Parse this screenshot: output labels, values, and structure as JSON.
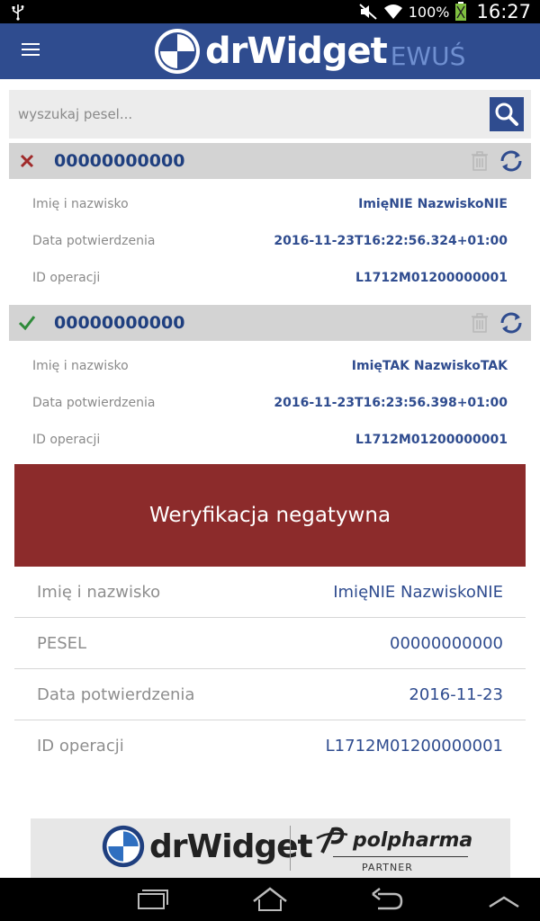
{
  "status_bar": {
    "battery": "100%",
    "time": "16:27"
  },
  "app_bar": {
    "brand": "drWidget",
    "brand_sub": "EWUŚ"
  },
  "search": {
    "placeholder": "wyszukaj pesel..."
  },
  "records": [
    {
      "status": "negative",
      "pesel": "00000000000",
      "rows": [
        {
          "label": "Imię i nazwisko",
          "value": "ImięNIE NazwiskoNIE"
        },
        {
          "label": "Data potwierdzenia",
          "value": "2016-11-23T16:22:56.324+01:00"
        },
        {
          "label": "ID operacji",
          "value": "L1712M01200000001"
        }
      ]
    },
    {
      "status": "positive",
      "pesel": "00000000000",
      "rows": [
        {
          "label": "Imię i nazwisko",
          "value": "ImięTAK NazwiskoTAK"
        },
        {
          "label": "Data potwierdzenia",
          "value": "2016-11-23T16:23:56.398+01:00"
        },
        {
          "label": "ID operacji",
          "value": "L1712M01200000001"
        }
      ]
    }
  ],
  "details": {
    "verdict": "Weryfikacja negatywna",
    "rows": [
      {
        "label": "Imię i nazwisko",
        "value": "ImięNIE NazwiskoNIE"
      },
      {
        "label": "PESEL",
        "value": "00000000000"
      },
      {
        "label": "Data potwierdzenia",
        "value": "2016-11-23"
      },
      {
        "label": "ID operacji",
        "value": "L1712M01200000001"
      }
    ]
  },
  "footer": {
    "brand": "drWidget",
    "partner_brand": "polpharma",
    "partner_label": "PARTNER"
  },
  "colors": {
    "primary": "#2f4c8f",
    "negative": "#8c2b2b",
    "positive_check": "#2e8b3a",
    "negative_x": "#a02a2a"
  }
}
